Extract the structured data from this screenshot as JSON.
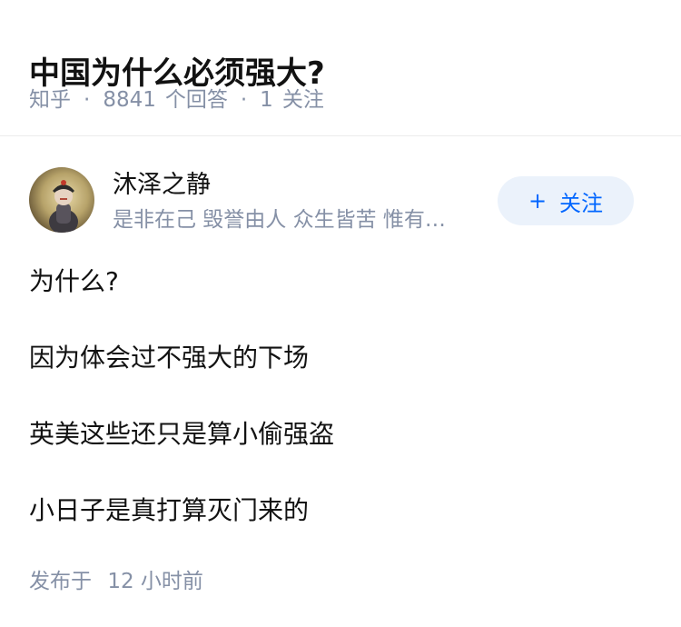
{
  "question": {
    "title": "中国为什么必须强大?",
    "source": "知乎",
    "answer_count": "8841",
    "answer_label": "个回答",
    "follow_count": "1",
    "follow_label": "关注"
  },
  "author": {
    "name": "沐泽之静",
    "bio": "是非在己 毁誉由人 众生皆苦 惟有…",
    "follow_button_label": "+ 关注",
    "follow_button_plus": "+",
    "follow_button_text": "关注"
  },
  "answer": {
    "paragraphs": [
      "为什么?",
      "因为体会过不强大的下场",
      "英美这些还只是算小偷强盗",
      "小日子是真打算灭门来的"
    ],
    "publish_label": "发布于",
    "publish_time": "12 小时前"
  },
  "colors": {
    "text": "#121212",
    "meta": "#8590a6",
    "accent": "#0066ff",
    "button_bg": "#ebf2fb",
    "divider": "#ebebeb"
  }
}
